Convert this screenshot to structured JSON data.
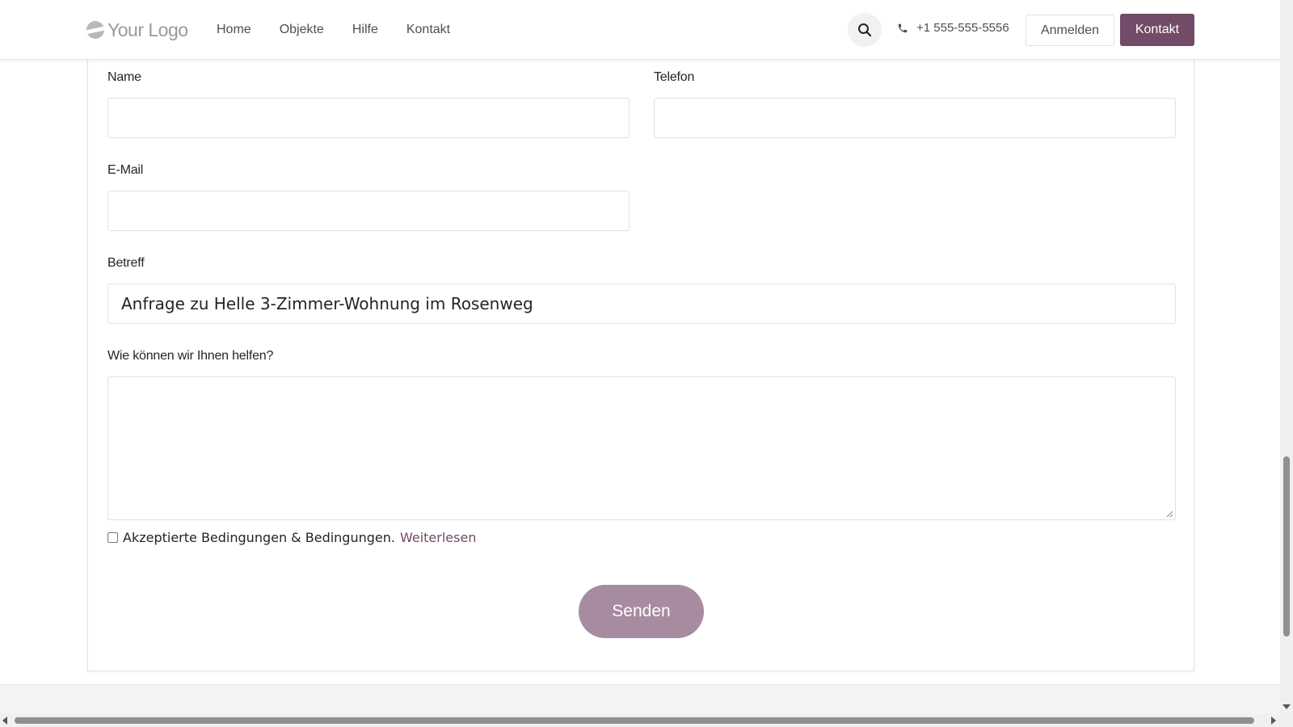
{
  "header": {
    "logo_text": "Your Logo",
    "nav": [
      "Home",
      "Objekte",
      "Hilfe",
      "Kontakt"
    ],
    "phone": "+1 555-555-5556",
    "login_label": "Anmelden",
    "contact_label": "Kontakt",
    "accent_color": "#714b67"
  },
  "form": {
    "name_label": "Name",
    "phone_label": "Telefon",
    "email_label": "E-Mail",
    "subject_label": "Betreff",
    "subject_value": "Anfrage zu Helle 3-Zimmer-Wohnung im Rosenweg",
    "message_label": "Wie können wir Ihnen helfen?",
    "terms_text": "Akzeptierte Bedingungen & Bedingungen.",
    "terms_link": "Weiterlesen",
    "submit_label": "Senden"
  },
  "icons": {
    "search": "search-icon",
    "phone": "phone-icon"
  }
}
